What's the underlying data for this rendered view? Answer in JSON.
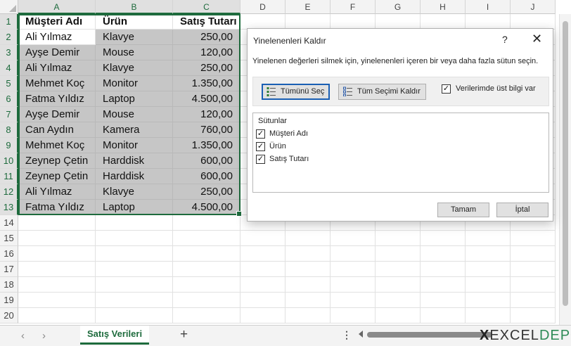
{
  "columns": [
    "A",
    "B",
    "C",
    "D",
    "E",
    "F",
    "G",
    "H",
    "I",
    "J"
  ],
  "rows": [
    "1",
    "2",
    "3",
    "4",
    "5",
    "6",
    "7",
    "8",
    "9",
    "10",
    "11",
    "12",
    "13",
    "14",
    "15",
    "16",
    "17",
    "18",
    "19",
    "20"
  ],
  "table": {
    "headers": [
      "Müşteri Adı",
      "Ürün",
      "Satış Tutarı"
    ],
    "rows": [
      [
        "Ali Yılmaz",
        "Klavye",
        "250,00"
      ],
      [
        "Ayşe Demir",
        "Mouse",
        "120,00"
      ],
      [
        "Ali Yılmaz",
        "Klavye",
        "250,00"
      ],
      [
        "Mehmet Koç",
        "Monitor",
        "1.350,00"
      ],
      [
        "Fatma Yıldız",
        "Laptop",
        "4.500,00"
      ],
      [
        "Ayşe Demir",
        "Mouse",
        "120,00"
      ],
      [
        "Can Aydın",
        "Kamera",
        "760,00"
      ],
      [
        "Mehmet Koç",
        "Monitor",
        "1.350,00"
      ],
      [
        "Zeynep Çetin",
        "Harddisk",
        "600,00"
      ],
      [
        "Zeynep Çetin",
        "Harddisk",
        "600,00"
      ],
      [
        "Ali Yılmaz",
        "Klavye",
        "250,00"
      ],
      [
        "Fatma Yıldız",
        "Laptop",
        "4.500,00"
      ]
    ]
  },
  "dialog": {
    "title": "Yinelenenleri Kaldır",
    "help": "?",
    "close": "✕",
    "description": "Yinelenen değerleri silmek için, yinelenenleri içeren bir veya daha fazla sütun seçin.",
    "select_all": "Tümünü Seç",
    "unselect_all": "Tüm Seçimi Kaldır",
    "has_headers": "Verilerimde üst bilgi var",
    "columns_label": "Sütunlar",
    "column_items": [
      "Müşteri Adı",
      "Ürün",
      "Satış Tutarı"
    ],
    "ok": "Tamam",
    "cancel": "İptal",
    "check_mark": "✓"
  },
  "sheetbar": {
    "prev": "‹",
    "next": "›",
    "tab": "Satış Verileri",
    "add": "+",
    "more": "⋮"
  },
  "logo": {
    "x": "X",
    "part1": "EXCEL",
    "part2": "DEPO"
  },
  "colors": {
    "accent": "#1e6b3d",
    "selection": "#c6c6c6"
  }
}
